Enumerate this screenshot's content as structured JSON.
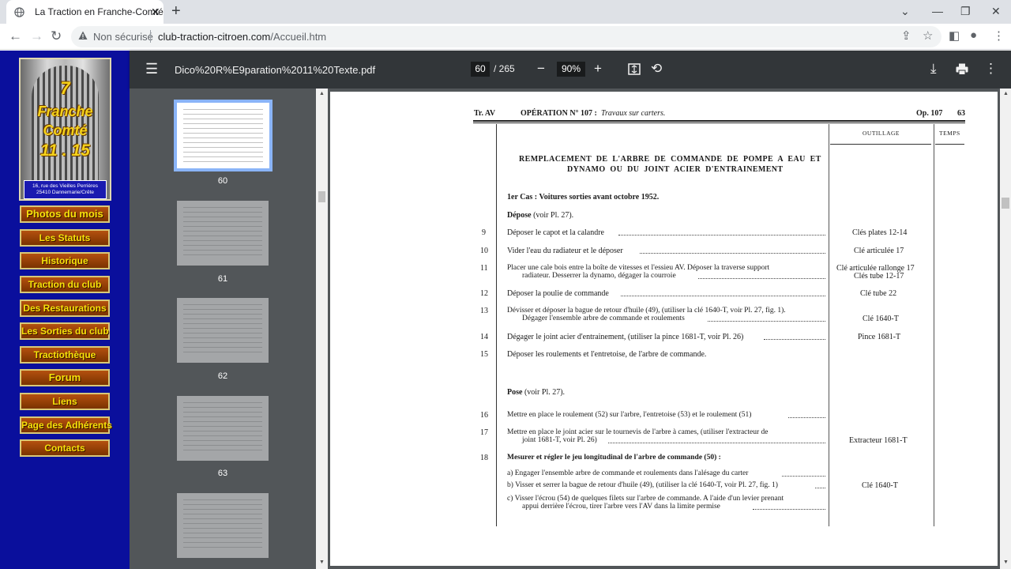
{
  "browser": {
    "tab_title": "La Traction en Franche-Comté",
    "security_label": "Non sécurisé",
    "url_domain": "club-traction-citroen.com",
    "url_path": "/Accueil.htm"
  },
  "site": {
    "logo_number": "7",
    "logo_line1": "Franche",
    "logo_line2": "Comté",
    "logo_year": "11 . 15",
    "logo_address1": "16, rue des Vieilles Perrières",
    "logo_address2": "25410 Dannemarie/Crête",
    "nav": [
      "Photos du mois",
      "Les Statuts",
      "Historique",
      "Traction du club",
      "Des Restaurations",
      "Les Sorties du club",
      "Tractiothèque",
      "Forum",
      "Liens",
      "Page des Adhérents",
      "Contacts"
    ]
  },
  "pdf": {
    "filename": "Dico%20R%E9paration%2011%20Texte.pdf",
    "current_page": "60",
    "total_pages": "/ 265",
    "zoom": "90%",
    "thumbnails": [
      "60",
      "61",
      "62",
      "63"
    ]
  },
  "document": {
    "header_left": "Tr. AV",
    "header_op": "OPÉRATION N° 107 :",
    "header_op_sub": "Travaux sur carters.",
    "header_right": "Op. 107",
    "page_number": "63",
    "col_outillage": "OUTILLAGE",
    "col_temps": "TEMPS",
    "title_line1": "REMPLACEMENT DE L'ARBRE DE COMMANDE DE POMPE A EAU ET",
    "title_line2": "DYNAMO OU DU JOINT ACIER D'ENTRAINEMENT",
    "case1": "1er Cas : Voitures sorties avant octobre 1952.",
    "depose_heading": "Dépose",
    "depose_ref": "(voir Pl. 27).",
    "pose_heading": "Pose",
    "pose_ref": "(voir Pl. 27).",
    "rows": [
      {
        "n": "9",
        "text": "Déposer le capot et la calandre",
        "tool": "Clés plates 12-14"
      },
      {
        "n": "10",
        "text": "Vider l'eau du radiateur et le déposer",
        "tool": "Clé articulée 17"
      },
      {
        "n": "11",
        "text": "Placer une cale bois entre la boîte de vitesses et l'essieu AV. Déposer la traverse support",
        "text2": "radiateur. Desserrer la dynamo, dégager la courroie",
        "tool": "Clé articulée rallonge 17",
        "tool2": "Clés tube 12-17"
      },
      {
        "n": "12",
        "text": "Déposer la poulie de commande",
        "tool": "Clé tube 22"
      },
      {
        "n": "13",
        "text": "Dévisser et déposer la bague de retour d'huile (49), (utiliser la clé 1640-T, voir Pl. 27, fig. 1).",
        "text2": "Dégager l'ensemble arbre de commande et roulements",
        "tool": "",
        "tool2": "Clé 1640-T"
      },
      {
        "n": "14",
        "text": "Dégager le joint acier d'entrainement, (utiliser la pince 1681-T, voir Pl. 26)",
        "tool": "Pince 1681-T"
      },
      {
        "n": "15",
        "text": "Déposer les roulements et l'entretoise, de l'arbre de commande.",
        "tool": ""
      },
      {
        "n": "16",
        "text": "Mettre en place le roulement (52) sur l'arbre, l'entretoise (53) et le roulement (51)",
        "tool": ""
      },
      {
        "n": "17",
        "text": "Mettre en place le joint acier sur le tournevis de l'arbre à cames, (utiliser l'extracteur de",
        "text2": "joint 1681-T, voir Pl. 26)",
        "tool": "",
        "tool2": "Extracteur 1681-T"
      },
      {
        "n": "18",
        "text": "Mesurer et régler le jeu longitudinal de l'arbre de commande (50) :",
        "tool": ""
      }
    ],
    "sub_a": "a) Engager l'ensemble arbre de commande et roulements dans l'alésage du carter",
    "sub_b": "b) Visser et serrer la bague de retour d'huile (49), (utiliser la clé 1640-T, voir Pl. 27, fig. 1)",
    "sub_b_tool": "Clé 1640-T",
    "sub_c1": "c) Visser l'écrou (54) de quelques filets sur l'arbre de commande. A l'aide d'un levier prenant",
    "sub_c2": "appui derrière l'écrou, tirer l'arbre vers l'AV dans la limite permise"
  }
}
